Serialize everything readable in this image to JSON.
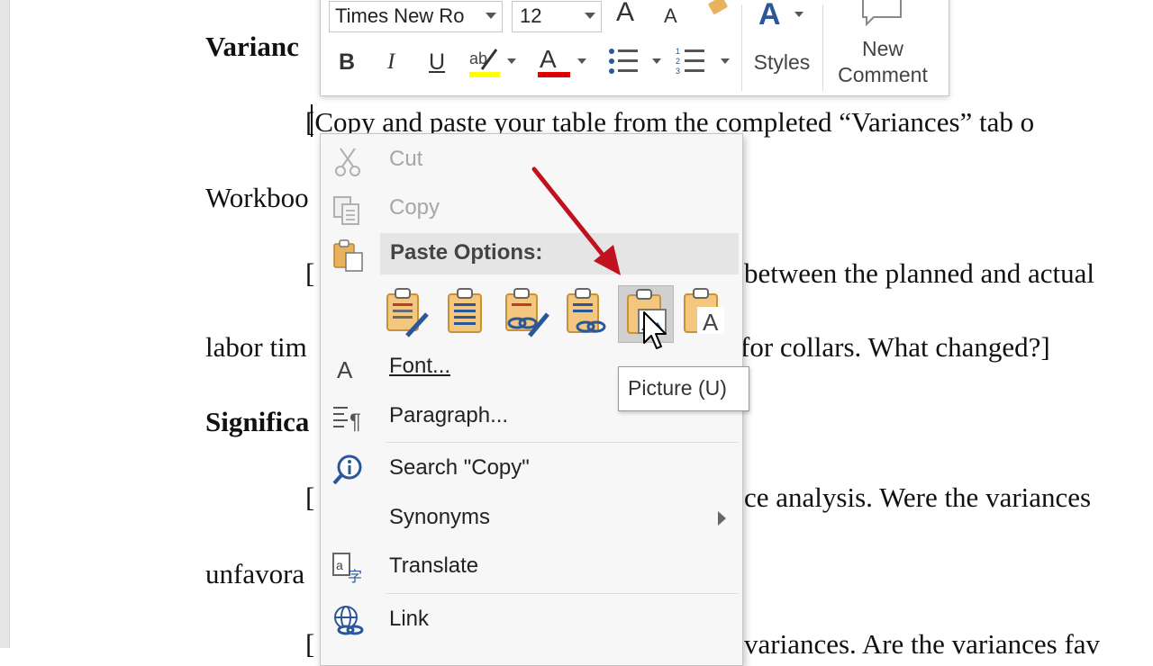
{
  "document": {
    "heading_variances": "Varianc",
    "para1_line1": "[Copy and paste your table from the completed “Variances” tab o",
    "para1_line2": "Workboo",
    "para2_bracket": "[",
    "para2_line1_right": "between the planned and actual",
    "para2_line2_left": "labor tim",
    "para2_line2_right": "for collars. What changed?]",
    "heading_significance": "Significa",
    "para3_bracket": "[",
    "para3_line1_right": "ce analysis. Were the variances",
    "para3_line2_left": "unfavora",
    "para4_bracket": "[",
    "para4_line1_right": "variances. Are the variances fav"
  },
  "mini_toolbar": {
    "font_name": "Times New Ro",
    "font_size": "12",
    "bold_label": "B",
    "italic_label": "I",
    "underline_label": "U",
    "grow_font_label": "A",
    "shrink_font_label": "A",
    "highlight_color": "#ffff00",
    "font_color": "#e00000",
    "styles_label": "Styles",
    "new_comment_line1": "New",
    "new_comment_line2": "Comment"
  },
  "context_menu": {
    "cut": "Cut",
    "copy": "Copy",
    "paste_options": "Paste Options:",
    "paste_buttons": [
      "keep-source-formatting",
      "merge-formatting",
      "linked-keep-source",
      "linked-merge",
      "picture",
      "keep-text-only"
    ],
    "font": "Font...",
    "paragraph": "Paragraph...",
    "search": "Search \"Copy\"",
    "synonyms": "Synonyms",
    "translate": "Translate",
    "link": "Link"
  },
  "tooltip": {
    "text": "Picture (U)"
  },
  "colors": {
    "accent_blue": "#2b579a",
    "annotation_arrow": "#c0111f",
    "clipboard_tan": "#e8b35c"
  }
}
